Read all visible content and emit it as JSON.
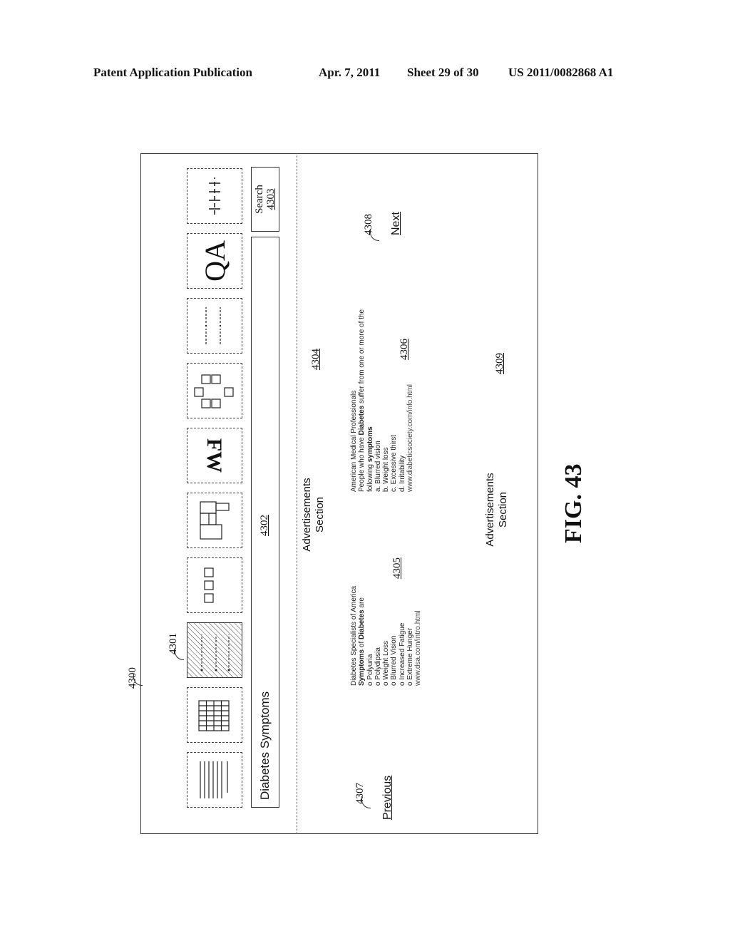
{
  "header": {
    "publication": "Patent Application Publication",
    "date": "Apr. 7, 2011",
    "sheet": "Sheet 29 of 30",
    "number": "US 2011/0082868 A1"
  },
  "figure": {
    "label": "FIG. 43",
    "ref_main": "4300",
    "ref_toolbar": "4301",
    "ref_search_bar": "4302",
    "ref_search_button": "4303",
    "ref_ads_top": "4304",
    "ref_result_1": "4305",
    "ref_result_2": "4306",
    "ref_previous": "4307",
    "ref_next": "4308",
    "ref_ads_bottom": "4309"
  },
  "toolbar": {
    "icons": [
      {
        "name": "lines-view-icon"
      },
      {
        "name": "grid-view-icon"
      },
      {
        "name": "hatched-columns-icon",
        "selected": true
      },
      {
        "name": "three-boxes-icon"
      },
      {
        "name": "stacked-blocks-icon"
      },
      {
        "name": "fw-icon",
        "text": "FW"
      },
      {
        "name": "box-cluster-icon"
      },
      {
        "name": "dashed-columns-icon"
      },
      {
        "name": "qa-icon",
        "text": "QA"
      },
      {
        "name": "timeline-icon"
      }
    ]
  },
  "search": {
    "value": "Diabetes Symptoms",
    "button_label": "Search"
  },
  "navigation": {
    "previous": "Previous",
    "next": "Next"
  },
  "ads": {
    "top_line1": "Advertisements",
    "top_line2": "Section",
    "bottom_line1": "Advertisements",
    "bottom_line2": "Section"
  },
  "results": [
    {
      "source": "Diabetes Specialists of America",
      "heading_bold1": "Symptoms",
      "heading_mid": " of ",
      "heading_bold2": "Diabetes",
      "heading_end": " are",
      "items": [
        "o Polyuria",
        "o Polydipsia",
        "o Weight Loss",
        "o Blurred Vision",
        "o Increased Fatigue",
        "o Extreme Hunger"
      ],
      "url": "www.dsa.com/intro.html"
    },
    {
      "source": "American Medical Professionals",
      "line2_start": "People who have ",
      "line2_bold": "Diabetes",
      "line2_end": " suffer from one or more of the",
      "line3_start": "following ",
      "line3_bold": "symptoms",
      "items": [
        "a. Blurred vision",
        "b. Weight loss",
        "c. Excessive thirst",
        "d. Irritability"
      ],
      "url": "www.diabeticsociety.com/info.html"
    }
  ]
}
